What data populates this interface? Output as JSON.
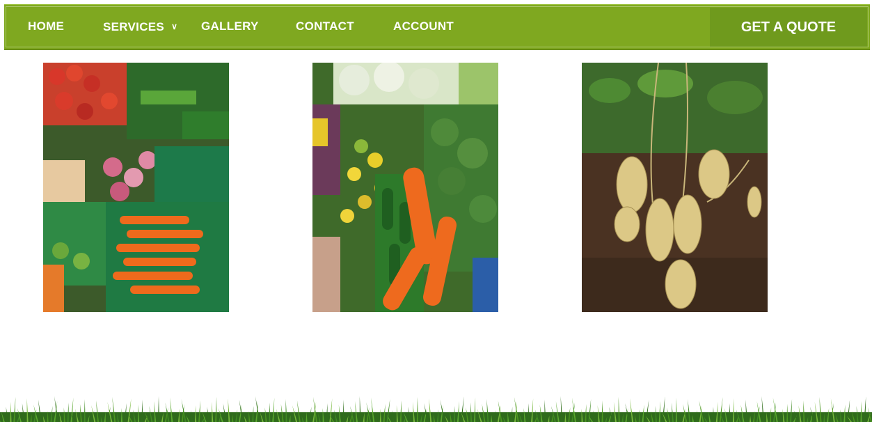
{
  "nav": {
    "items": [
      {
        "label": "HOME"
      },
      {
        "label": "SERVICES",
        "has_dropdown": true
      },
      {
        "label": "GALLERY"
      },
      {
        "label": "CONTACT"
      },
      {
        "label": "ACCOUNT"
      }
    ],
    "cta_label": "GET A QUOTE",
    "bar_color": "#7fa820",
    "cta_color": "#6f9a1d"
  },
  "gallery": {
    "images": [
      {
        "subject": "market crates of carrots, tomatoes and radishes"
      },
      {
        "subject": "display of peppers, broccoli and carrots"
      },
      {
        "subject": "potatoes being harvested from soil"
      }
    ]
  },
  "footer": {
    "decoration": "grass-border"
  }
}
